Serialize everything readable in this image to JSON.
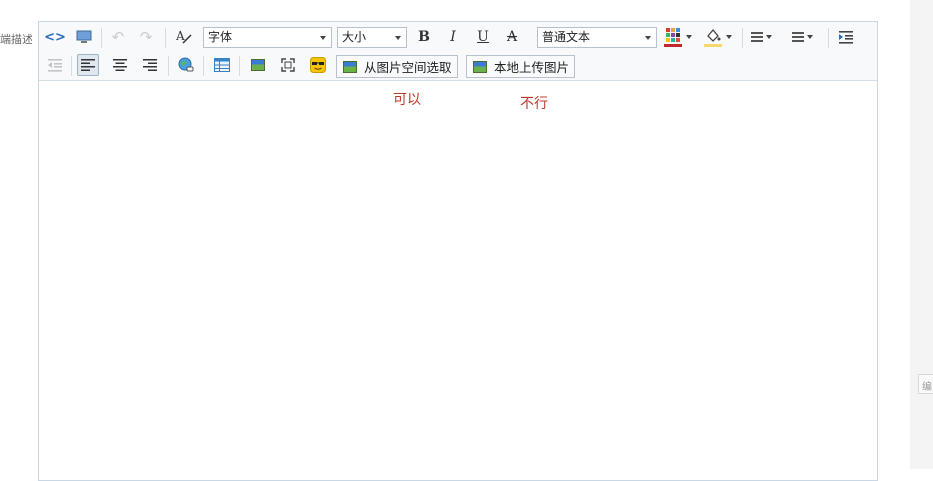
{
  "field_label": "端描述",
  "toolbar": {
    "font_family": "字体",
    "font_size": "大小",
    "paragraph_format": "普通文本",
    "bold": "B",
    "italic": "I",
    "underline": "U",
    "strikethrough": "A",
    "insert_from_space": "从图片空间选取",
    "upload_local": "本地上传图片",
    "font_color": "#c0282d",
    "highlight_color": "#f5d76e"
  },
  "annotations": {
    "works": "可以",
    "not_works": "不行"
  },
  "side_tab": "编"
}
